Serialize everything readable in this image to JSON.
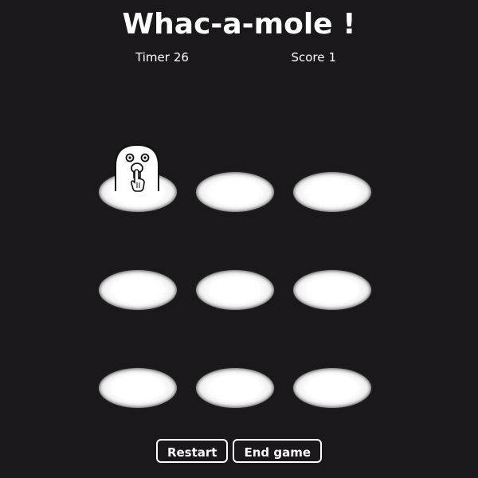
{
  "title": "Whac-a-mole !",
  "hud": {
    "timer_label": "Timer",
    "timer_value": "26",
    "score_label": "Score",
    "score_value": "1"
  },
  "board": {
    "rows": 3,
    "cols": 3,
    "active_mole": {
      "row": 0,
      "col": 0
    }
  },
  "buttons": {
    "restart": "Restart",
    "end_game": "End game"
  },
  "colors": {
    "background": "#1a181a",
    "text": "#ffffff",
    "hole": "#ffffff"
  }
}
